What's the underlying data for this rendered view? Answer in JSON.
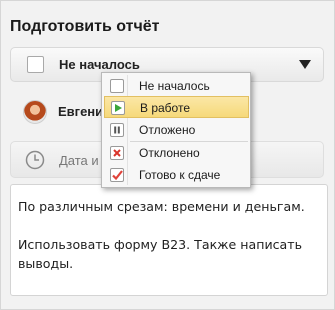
{
  "form": {
    "title": "Подготовить отчёт",
    "status_value": "Не началось",
    "assignee_name": "Евгени",
    "date_label": "Дата и",
    "comment_lines": [
      "По различным срезам: времени и деньгам.",
      "Использовать форму B23. Также написать выводы."
    ]
  },
  "status_menu": {
    "items": [
      {
        "label": "Не началось",
        "icon": "empty-checkbox-icon"
      },
      {
        "label": "В работе",
        "icon": "play-icon",
        "selected": true
      },
      {
        "label": "Отложено",
        "icon": "pause-icon"
      },
      {
        "label": "Отклонено",
        "icon": "cross-icon"
      },
      {
        "label": "Готово к сдаче",
        "icon": "checkmark-icon"
      }
    ]
  },
  "colors": {
    "selected_bg": "#f6d97a",
    "play_green": "#3aa63a",
    "cross_red": "#d9342b",
    "check_red": "#e0433a"
  }
}
